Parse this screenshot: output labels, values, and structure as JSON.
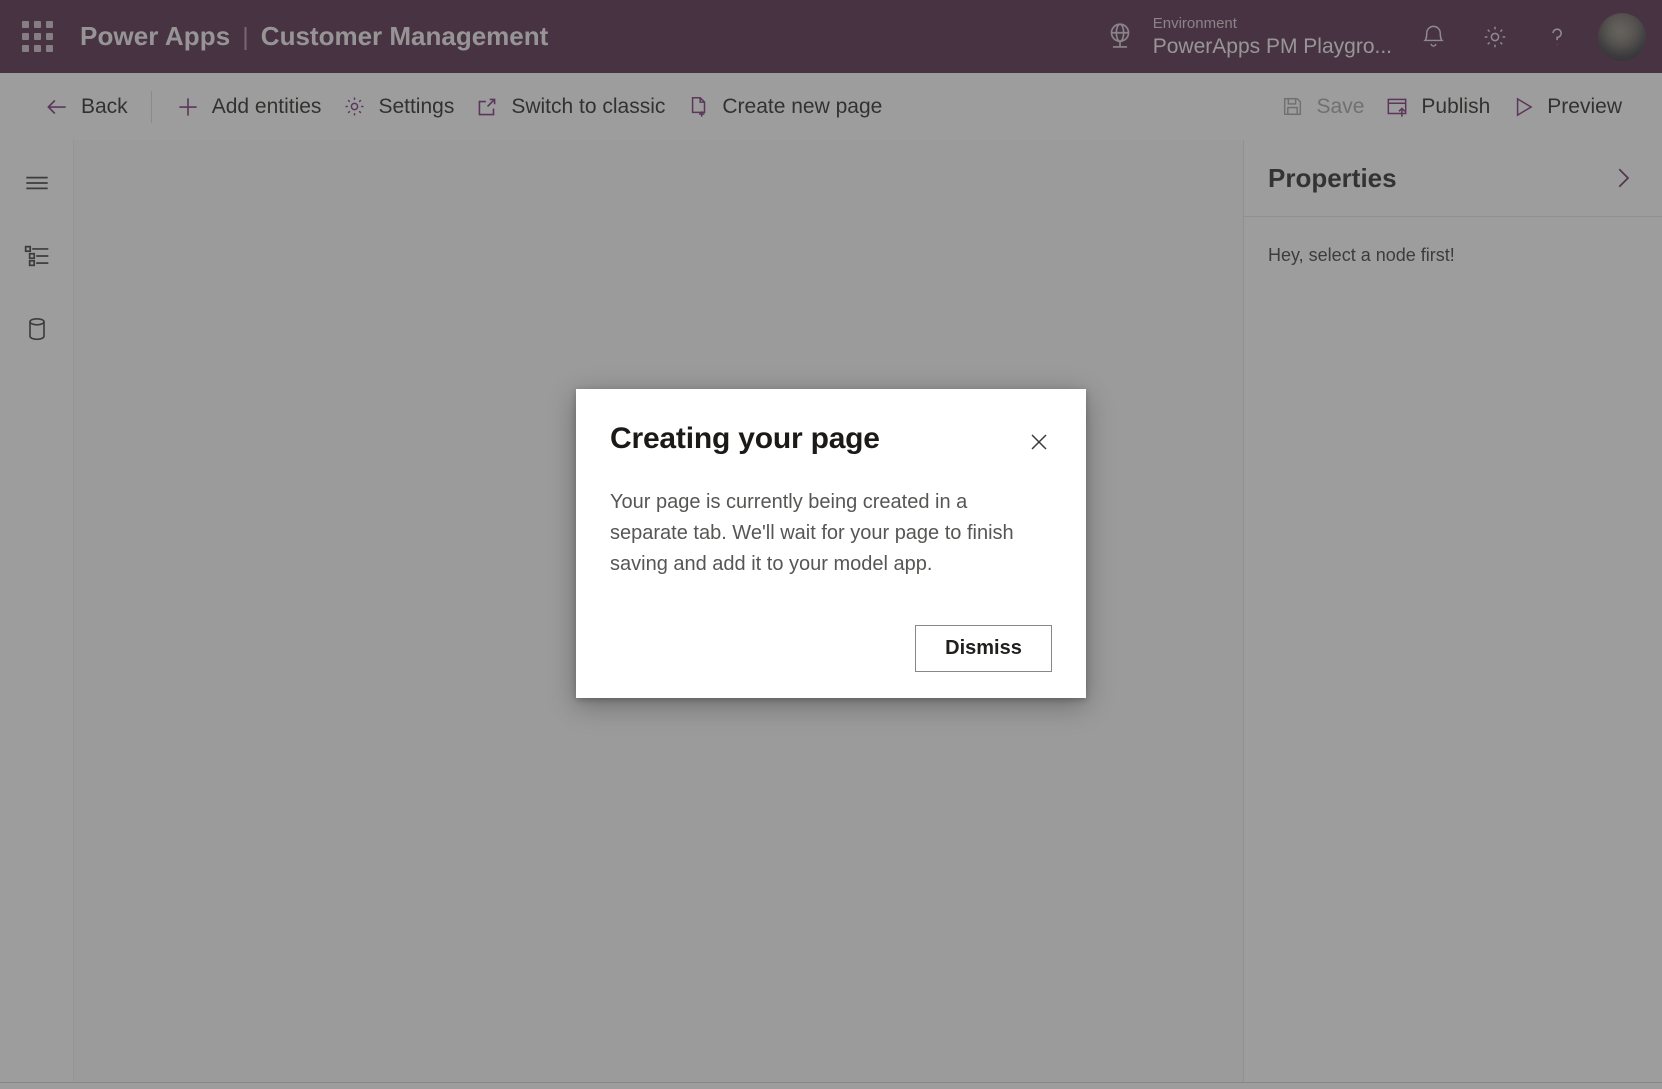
{
  "header": {
    "waffle_icon": "app-launcher-grid-icon",
    "product": "Power Apps",
    "separator": "|",
    "app_name": "Customer Management",
    "environment_label": "Environment",
    "environment_value": "PowerApps PM Playgro...",
    "globe_icon": "globe-icon",
    "notification_icon": "bell-icon",
    "settings_icon": "gear-icon",
    "help_icon": "question-mark-icon",
    "avatar_icon": "user-avatar",
    "bar_color": "#4c1f40"
  },
  "commandbar": {
    "back": "Back",
    "add_entities": "Add entities",
    "settings": "Settings",
    "switch_to_classic": "Switch to classic",
    "create_new_page": "Create new page",
    "save": "Save",
    "publish": "Publish",
    "preview": "Preview",
    "save_disabled": true,
    "accent_color": "#742774"
  },
  "rail": {
    "items": [
      {
        "icon": "hamburger-menu-icon",
        "name": "navigation-menu"
      },
      {
        "icon": "tree-view-icon",
        "name": "site-map-tree"
      },
      {
        "icon": "database-icon",
        "name": "data-entities"
      }
    ]
  },
  "properties_panel": {
    "title": "Properties",
    "collapse_icon": "chevron-right-icon",
    "empty_message": "Hey, select a node first!"
  },
  "dialog": {
    "title": "Creating your page",
    "close_icon": "close-icon",
    "body": "Your page is currently being created in a separate tab. We'll wait for your page to finish saving and add it to your model app.",
    "dismiss_label": "Dismiss"
  }
}
